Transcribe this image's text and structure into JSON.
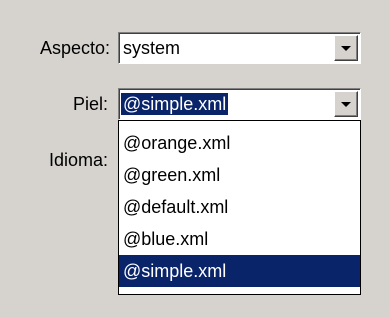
{
  "form": {
    "aspecto": {
      "label": "Aspecto:",
      "value": "system"
    },
    "piel": {
      "label": "Piel:",
      "value": "@simple.xml",
      "options": [
        "@orange.xml",
        "@green.xml",
        "@default.xml",
        "@blue.xml",
        "@simple.xml"
      ],
      "highlighted_option": "@simple.xml"
    },
    "idioma": {
      "label": "Idioma:"
    }
  },
  "colors": {
    "window_bg": "#d6d3ce",
    "selection_bg": "#0a246a",
    "selection_text": "#ffffff"
  },
  "icons": {
    "dropdown_arrow": "chevron-down-icon"
  }
}
